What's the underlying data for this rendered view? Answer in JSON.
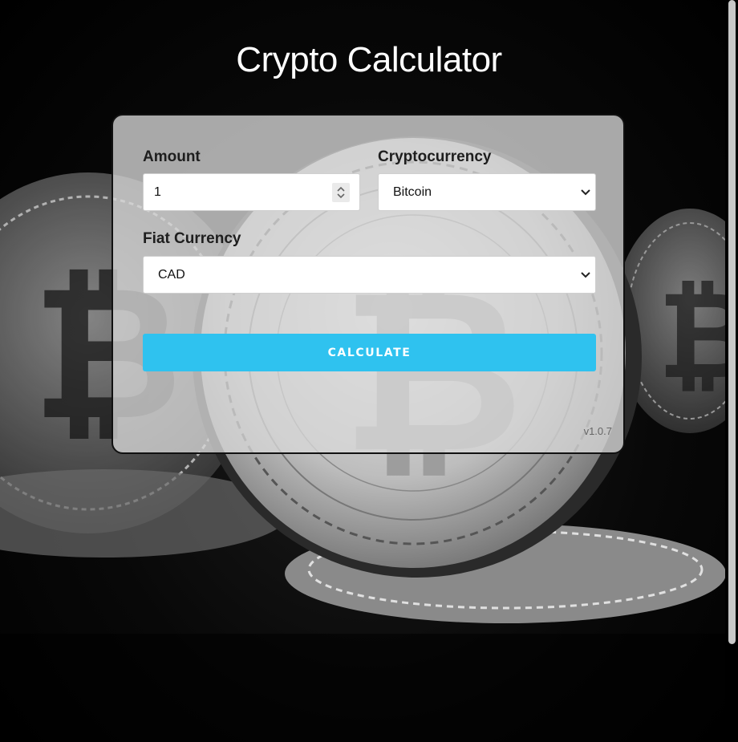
{
  "page": {
    "title": "Crypto Calculator",
    "background": "bitcoin-coins-photo"
  },
  "form": {
    "amount": {
      "label": "Amount",
      "value": "1"
    },
    "cryptocurrency": {
      "label": "Cryptocurrency",
      "selected": "Bitcoin"
    },
    "fiat": {
      "label": "Fiat Currency",
      "selected": "CAD"
    },
    "calculate_label": "CALCULATE",
    "version": "v1.0.7"
  },
  "colors": {
    "accent": "#2fc2ef",
    "card": "#d7d7d7",
    "background": "#000000"
  },
  "scrollbar": {
    "position_fraction": 0.0
  }
}
